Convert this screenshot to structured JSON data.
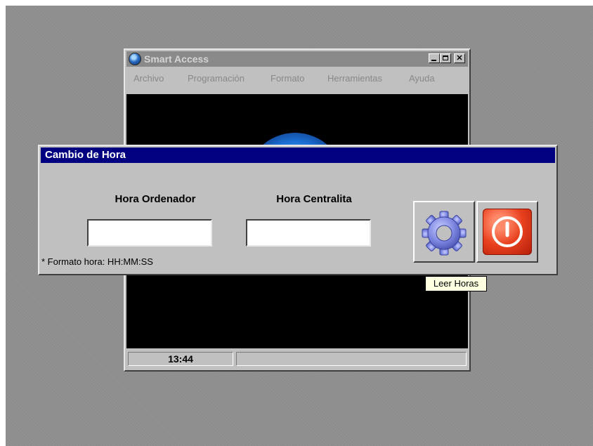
{
  "main_window": {
    "title": "Smart Access",
    "menu": [
      "Archivo",
      "Programación",
      "Formato",
      "Herramientas",
      "Ayuda"
    ],
    "status_time": "13:44"
  },
  "dialog": {
    "title": "Cambio de Hora",
    "label_pc": "Hora Ordenador",
    "label_pbx": "Hora Centralita",
    "value_pc": "",
    "value_pbx": "",
    "format_note": "* Formato hora: HH:MM:SS",
    "read_icon": "gear-icon",
    "exit_icon": "power-icon"
  },
  "tooltip": "Leer Horas",
  "colors": {
    "dialog_title_bg": "#000080",
    "desktop": "#8d8d8d",
    "inactive_title": "#8a8a8a",
    "exit_red": "#e8401e",
    "gear_blue": "#7c86e0"
  }
}
